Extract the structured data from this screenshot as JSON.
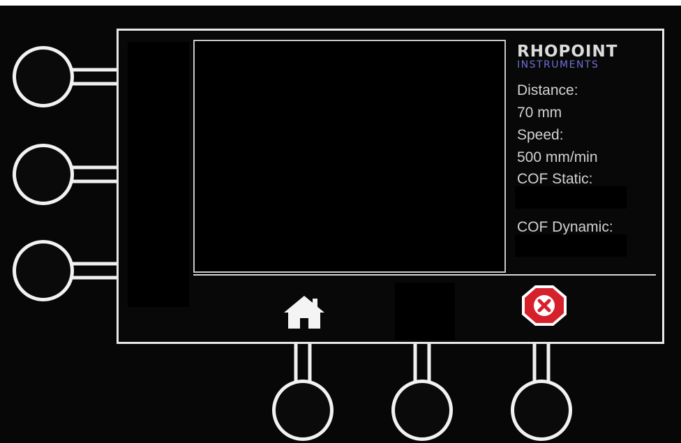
{
  "brand": {
    "name": "RHOPOINT",
    "subtitle": "INSTRUMENTS"
  },
  "readouts": {
    "distance_label": "Distance:",
    "distance_value": "70 mm",
    "speed_label": "Speed:",
    "speed_value": "500 mm/min",
    "cof_static_label": "COF Static:",
    "cof_static_value": "",
    "cof_dynamic_label": "COF Dynamic:",
    "cof_dynamic_value": ""
  },
  "icons": {
    "home": "home-icon",
    "cancel": "cancel-icon"
  },
  "colors": {
    "background": "#070707",
    "frame": "#e8e8e8",
    "text": "#d2d2d2",
    "brand_accent": "#6f6fd8",
    "cancel_red": "#d6202c"
  }
}
